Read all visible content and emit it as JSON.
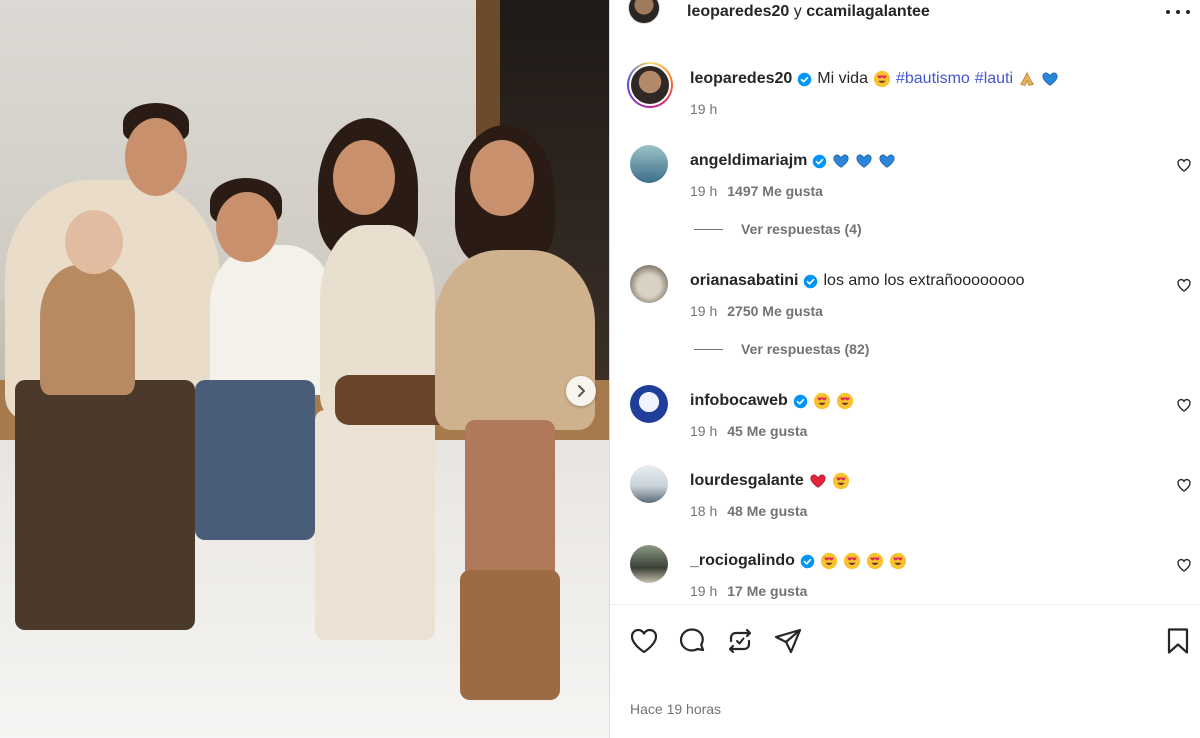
{
  "header": {
    "author": "leoparedes20",
    "connector": "y",
    "coauthor": "ccamilagalantee"
  },
  "caption": {
    "username": "leoparedes20",
    "text": "Mi vida",
    "hashtags": [
      "#bautismo",
      "#lauti"
    ],
    "time": "19 h"
  },
  "comments": [
    {
      "username": "angeldimariajm",
      "verified": true,
      "text": "",
      "emojis": [
        "blue-heart",
        "blue-heart",
        "blue-heart"
      ],
      "time": "19 h",
      "likes": "1497 Me gusta"
    },
    {
      "username": "orianasabatini",
      "verified": true,
      "text": "los amo los extrañoooooooo",
      "emojis": [],
      "time": "19 h",
      "likes": "2750 Me gusta"
    },
    {
      "username": "infobocaweb",
      "verified": true,
      "text": "",
      "emojis": [
        "heart-eyes",
        "heart-eyes"
      ],
      "time": "19 h",
      "likes": "45 Me gusta"
    },
    {
      "username": "lourdesgalante",
      "verified": false,
      "text": "",
      "emojis": [
        "red-heart",
        "heart-eyes"
      ],
      "time": "18 h",
      "likes": "48 Me gusta"
    },
    {
      "username": "_rociogalindo",
      "verified": true,
      "text": "",
      "emojis": [
        "heart-eyes",
        "heart-eyes",
        "heart-eyes",
        "heart-eyes"
      ],
      "time": "19 h",
      "likes": "17 Me gusta"
    }
  ],
  "replies": [
    {
      "label": "Ver respuestas (4)"
    },
    {
      "label": "Ver respuestas (82)"
    }
  ],
  "post_time": "Hace 19 horas",
  "colors": {
    "hashtag": "#4656d1",
    "verified": "#0095f6",
    "muted": "#737373",
    "text": "#262626"
  },
  "icons": [
    "like-icon",
    "comment-icon",
    "repost-icon",
    "share-icon",
    "save-icon",
    "more-options-icon",
    "next-arrow-icon"
  ]
}
